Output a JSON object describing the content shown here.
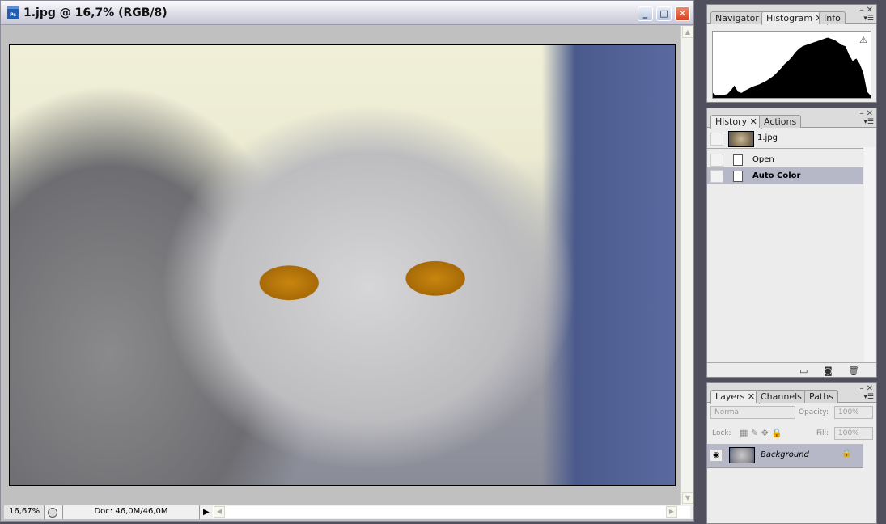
{
  "document": {
    "title": "1.jpg @ 16,7% (RGB/8)",
    "app_icon": "photoshop-icon",
    "controls": {
      "minimize": "_",
      "maximize": "□",
      "close": "✕"
    },
    "status": {
      "zoom": "16,67%",
      "doc_size": "Doc: 46,0M/46,0M",
      "arrow": "▶"
    }
  },
  "histogram_panel": {
    "tabs": [
      "Navigator",
      "Histogram ✕",
      "Info"
    ],
    "active_tab": "Histogram",
    "warning_icon": "⚠",
    "levels": [
      8,
      4,
      4,
      5,
      6,
      12,
      20,
      10,
      8,
      12,
      15,
      18,
      20,
      22,
      25,
      28,
      32,
      36,
      42,
      48,
      55,
      60,
      66,
      74,
      80,
      84,
      86,
      88,
      90,
      92,
      94,
      96,
      98,
      96,
      94,
      90,
      86,
      84,
      70,
      60,
      64,
      55,
      40,
      10,
      4
    ]
  },
  "history_panel": {
    "tabs": [
      "History ✕",
      "Actions"
    ],
    "snapshot_label": "1.jpg",
    "items": [
      {
        "label": "Open",
        "selected": false
      },
      {
        "label": "Auto Color",
        "selected": true
      }
    ]
  },
  "layers_panel": {
    "tabs": [
      "Layers ✕",
      "Channels",
      "Paths"
    ],
    "blend_mode": "Normal",
    "opacity_label": "Opacity:",
    "opacity": "100%",
    "lock_label": "Lock:",
    "fill_label": "Fill:",
    "fill": "100%",
    "layers": [
      {
        "name": "Background",
        "locked": true,
        "visible": true
      }
    ]
  },
  "colors": {
    "selection": "#b7b8c7",
    "panel": "#ececec",
    "canvas": "#c0c0c0"
  }
}
